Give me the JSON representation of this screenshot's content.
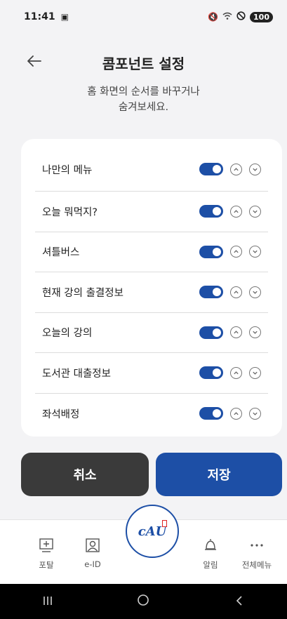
{
  "status_bar": {
    "time": "11:41",
    "battery": "100"
  },
  "header": {
    "title": "콤포넌트 설정",
    "subtitle_line1": "홈 화면의 순서를 바꾸거나",
    "subtitle_line2": "숨겨보세요."
  },
  "components": [
    {
      "label": "나만의 메뉴",
      "enabled": true
    },
    {
      "label": "오늘 뭐먹지?",
      "enabled": true
    },
    {
      "label": "셔틀버스",
      "enabled": true
    },
    {
      "label": "현재 강의 출결정보",
      "enabled": true
    },
    {
      "label": "오늘의 강의",
      "enabled": true
    },
    {
      "label": "도서관 대출정보",
      "enabled": true
    },
    {
      "label": "좌석배정",
      "enabled": true
    }
  ],
  "actions": {
    "cancel_label": "취소",
    "save_label": "저장"
  },
  "bottom_nav": {
    "portal_label": "포탈",
    "eid_label": "e-ID",
    "logo_text": "cAU",
    "alarm_label": "알림",
    "menu_label": "전체메뉴"
  },
  "colors": {
    "accent": "#1d4fa6",
    "cancel": "#3a3a3a",
    "background": "#f3f3f5"
  }
}
